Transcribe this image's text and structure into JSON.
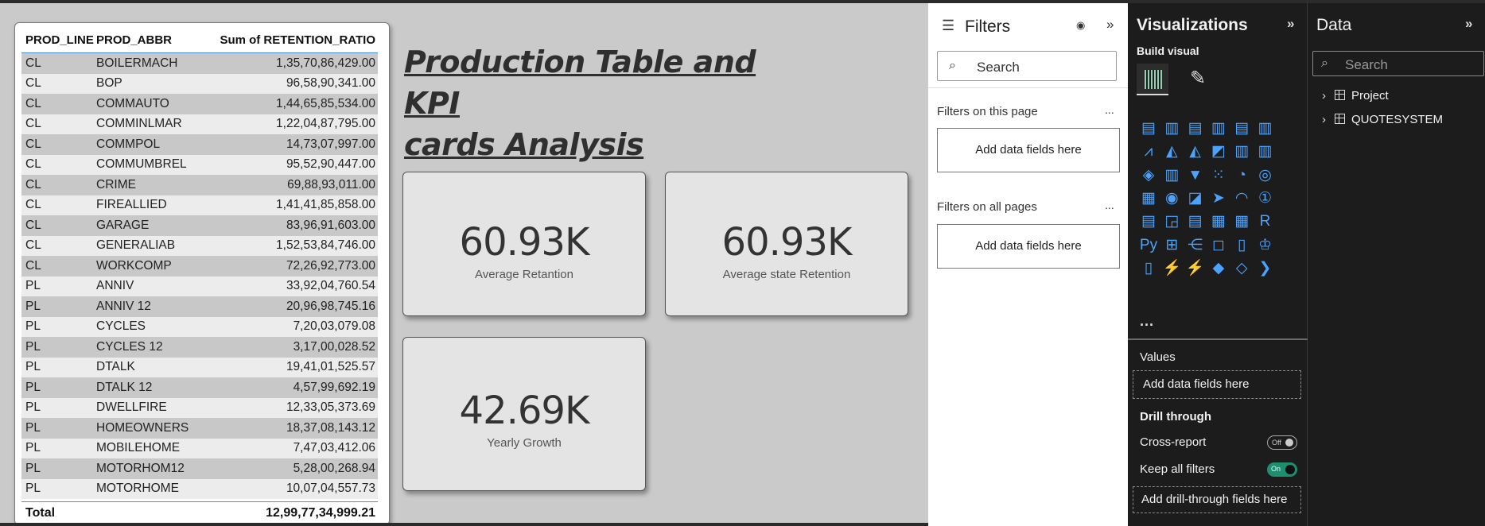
{
  "table": {
    "headers": [
      "PROD_LINE",
      "PROD_ABBR",
      "Sum of RETENTION_RATIO"
    ],
    "rows": [
      [
        "CL",
        "BOILERMACH",
        "1,35,70,86,429.00"
      ],
      [
        "CL",
        "BOP",
        "96,58,90,341.00"
      ],
      [
        "CL",
        "COMMAUTO",
        "1,44,65,85,534.00"
      ],
      [
        "CL",
        "COMMINLMAR",
        "1,22,04,87,795.00"
      ],
      [
        "CL",
        "COMMPOL",
        "14,73,07,997.00"
      ],
      [
        "CL",
        "COMMUMBREL",
        "95,52,90,447.00"
      ],
      [
        "CL",
        "CRIME",
        "69,88,93,011.00"
      ],
      [
        "CL",
        "FIREALLIED",
        "1,41,41,85,858.00"
      ],
      [
        "CL",
        "GARAGE",
        "83,96,91,603.00"
      ],
      [
        "CL",
        "GENERALIAB",
        "1,52,53,84,746.00"
      ],
      [
        "CL",
        "WORKCOMP",
        "72,26,92,773.00"
      ],
      [
        "PL",
        "ANNIV",
        "33,92,04,760.54"
      ],
      [
        "PL",
        "ANNIV 12",
        "20,96,98,745.16"
      ],
      [
        "PL",
        "CYCLES",
        "7,20,03,079.08"
      ],
      [
        "PL",
        "CYCLES 12",
        "3,17,00,028.52"
      ],
      [
        "PL",
        "DTALK",
        "19,41,01,525.57"
      ],
      [
        "PL",
        "DTALK 12",
        "4,57,99,692.19"
      ],
      [
        "PL",
        "DWELLFIRE",
        "12,33,05,373.69"
      ],
      [
        "PL",
        "HOMEOWNERS",
        "18,37,08,143.12"
      ],
      [
        "PL",
        "MOBILEHOME",
        "7,47,03,412.06"
      ],
      [
        "PL",
        "MOTORHOM12",
        "5,28,00,268.94"
      ],
      [
        "PL",
        "MOTORHOME",
        "10,07,04,557.73"
      ]
    ],
    "total_label": "Total",
    "total_value": "12,99,77,34,999.21"
  },
  "title": {
    "line1": "Production Table and KPI ",
    "line2": "cards Analysis"
  },
  "cards": [
    {
      "value": "60.93K",
      "label": "Average Retantion"
    },
    {
      "value": "60.93K",
      "label": "Average state Retention"
    },
    {
      "value": "42.69K",
      "label": "Yearly Growth"
    }
  ],
  "filters": {
    "title": "Filters",
    "search_placeholder": "Search",
    "on_this_page": "Filters on this page",
    "on_all_pages": "Filters on all pages",
    "add_fields": "Add data fields here",
    "more": "..."
  },
  "viz": {
    "title": "Visualizations",
    "build_visual": "Build visual",
    "more": "...",
    "values_label": "Values",
    "values_placeholder": "Add data fields here",
    "drill_through": "Drill through",
    "cross_report": "Cross-report",
    "cross_report_state": "Off",
    "keep_all_filters": "Keep all filters",
    "keep_all_filters_state": "On",
    "drill_placeholder": "Add drill-through fields here",
    "accent": "#4aa3ff",
    "icons": [
      "stacked-bar-icon",
      "clustered-column-icon",
      "clustered-bar-icon",
      "stacked-column-icon",
      "100-bar-icon",
      "100-column-icon",
      "line-chart-icon",
      "area-chart-icon",
      "stacked-area-icon",
      "100-area-icon",
      "line-column-icon",
      "line-clustered-icon",
      "ribbon-chart-icon",
      "waterfall-icon",
      "funnel-icon",
      "scatter-icon",
      "pie-chart-icon",
      "donut-chart-icon",
      "treemap-icon",
      "map-icon",
      "filled-map-icon",
      "azure-map-icon",
      "gauge-icon",
      "card-icon",
      "multirow-card-icon",
      "kpi-icon",
      "slicer-icon",
      "table-icon",
      "matrix-icon",
      "r-visual-icon",
      "python-visual-icon",
      "key-influencers-icon",
      "decomposition-tree-icon",
      "qa-icon",
      "narrative-icon",
      "goals-icon",
      "paginated-report-icon",
      "power-apps-icon",
      "power-automate-icon",
      "arcgis-icon",
      "fabric-icon",
      "more-visuals-icon"
    ],
    "glyphs": [
      "▤",
      "▥",
      "▤",
      "▥",
      "▤",
      "▥",
      "⩘",
      "◭",
      "◭",
      "◩",
      "▥",
      "▥",
      "◈",
      "▥",
      "▼",
      "⁙",
      "◔",
      "◎",
      "▦",
      "◉",
      "◪",
      "➤",
      "◠",
      "①",
      "▤",
      "◲",
      "▤",
      "▦",
      "▦",
      "R",
      "Py",
      "⊞",
      "⋲",
      "◻",
      "▯",
      "♔",
      "▯",
      "⚡",
      "⚡",
      "◆",
      "◇",
      "❯"
    ]
  },
  "data": {
    "title": "Data",
    "search_placeholder": "Search",
    "tables": [
      "Project",
      "QUOTESYSTEM"
    ]
  }
}
